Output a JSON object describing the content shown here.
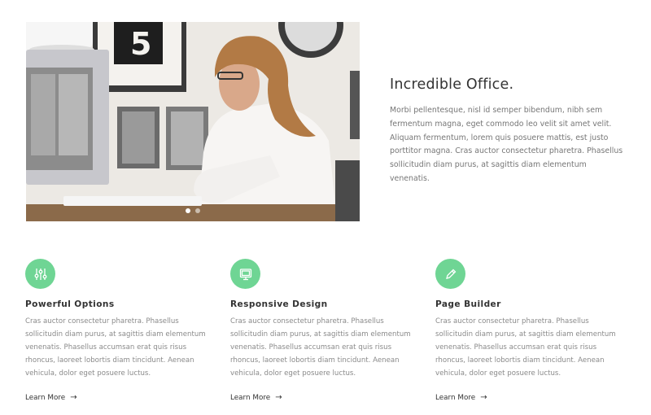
{
  "hero": {
    "image_alt": "Woman working at a desk in a bright office",
    "slider": {
      "count": 2,
      "active_index": 0
    }
  },
  "intro": {
    "title": "Incredible Office.",
    "body": "Morbi pellentesque, nisl id semper bibendum, nibh sem fermentum magna, eget commodo leo velit sit amet velit. Aliquam fermentum, lorem quis posuere mattis, est justo porttitor magna. Cras auctor consectetur pharetra. Phasellus sollicitudin diam purus, at sagittis diam elementum venenatis."
  },
  "features": [
    {
      "icon": "sliders-icon",
      "title": "Powerful Options",
      "text": "Cras auctor consectetur pharetra. Phasellus sollicitudin diam purus, at sagittis diam elementum venenatis. Phasellus accumsan erat quis risus rhoncus, laoreet lobortis diam tincidunt. Aenean vehicula, dolor eget posuere luctus.",
      "link": "Learn More"
    },
    {
      "icon": "monitor-icon",
      "title": "Responsive Design",
      "text": "Cras auctor consectetur pharetra. Phasellus sollicitudin diam purus, at sagittis diam elementum venenatis. Phasellus accumsan erat quis risus rhoncus, laoreet lobortis diam tincidunt. Aenean vehicula, dolor eget posuere luctus.",
      "link": "Learn More"
    },
    {
      "icon": "pencil-icon",
      "title": "Page Builder",
      "text": "Cras auctor consectetur pharetra. Phasellus sollicitudin diam purus, at sagittis diam elementum venenatis. Phasellus accumsan erat quis risus rhoncus, laoreet lobortis diam tincidunt. Aenean vehicula, dolor eget posuere luctus.",
      "link": "Learn More"
    }
  ],
  "colors": {
    "accent": "#6fd594",
    "heading": "#333333",
    "body_text": "#777777"
  }
}
